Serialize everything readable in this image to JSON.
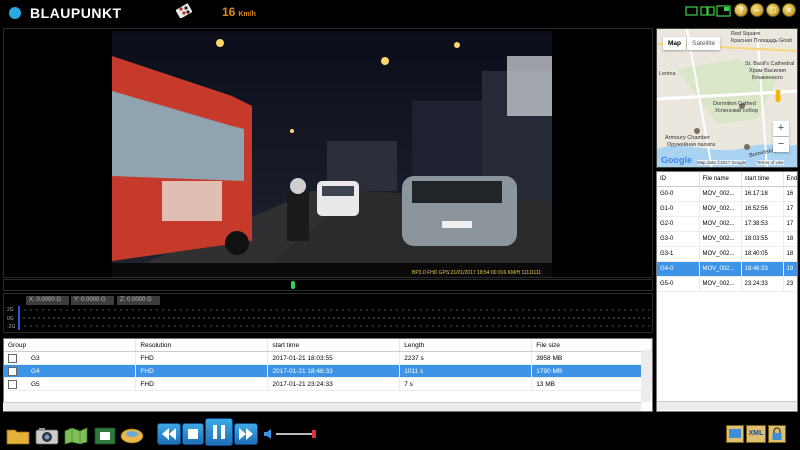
{
  "app": {
    "brand": "BLAUPUNKT"
  },
  "speed": {
    "value": "16",
    "unit": "Km/h"
  },
  "window_controls": [
    {
      "name": "help-button",
      "glyph": "?"
    },
    {
      "name": "minimize-button",
      "glyph": "–"
    },
    {
      "name": "maximize-button",
      "glyph": "□"
    },
    {
      "name": "close-button",
      "glyph": "×"
    }
  ],
  "video": {
    "overlay": "BP3.0 FHD GPS:21/01/2017 18:54:00 016 KM/H 11111111"
  },
  "gsensor": {
    "x_label": "X: 0.0000 G",
    "y_label": "Y: 0.0000 G",
    "z_label": "Z: 0.0000 G",
    "axis_ticks": [
      "2G",
      "0G",
      "-2G"
    ]
  },
  "group_table": {
    "headers": {
      "group": "Group",
      "resolution": "Resolution",
      "start_time": "start time",
      "length": "Length",
      "file_size": "File size"
    },
    "rows": [
      {
        "group": "G3",
        "resolution": "FHD",
        "start_time": "2017-01-21 18:03:55",
        "length": "2237 s",
        "file_size": "3958 MB"
      },
      {
        "group": "G4",
        "resolution": "FHD",
        "start_time": "2017-01-21 18:46:33",
        "length": "1011 s",
        "file_size": "1790 MB"
      },
      {
        "group": "G5",
        "resolution": "FHD",
        "start_time": "2017-01-21 23:24:33",
        "length": "7 s",
        "file_size": "13 MB"
      }
    ]
  },
  "map": {
    "tab_map": "Map",
    "tab_satellite": "Satellite",
    "labels": {
      "red_square": "Red Square",
      "red_square_ru": "Красная Площадь",
      "gosti": "Gosti",
      "cathedral": "St. Basil's Cathedral",
      "cathedral_ru1": "Храм Василия",
      "cathedral_ru2": "Блаженного",
      "lenina": "Lenina",
      "dormition": "Dormition Cathed",
      "dormition_ru": "Успенский собор",
      "armoury": "Armoury Chamber",
      "armoury_ru": "Оружейная палата",
      "street": "Borovitskaya pl."
    },
    "copyright": "Map data ©2017 Google",
    "terms": "Terms of Use",
    "google": "Google"
  },
  "file_list": {
    "headers": {
      "id": "ID",
      "file_name": "File name",
      "start_time": "start time",
      "end": "End"
    },
    "rows": [
      {
        "id": "G0-0",
        "file_name": "MOV_002...",
        "start_time": "16:17:18",
        "end": "16"
      },
      {
        "id": "G1-0",
        "file_name": "MOV_002...",
        "start_time": "16:52:56",
        "end": "17"
      },
      {
        "id": "G2-0",
        "file_name": "MOV_002...",
        "start_time": "17:38:53",
        "end": "17"
      },
      {
        "id": "G3-0",
        "file_name": "MOV_002...",
        "start_time": "18:03:55",
        "end": "18"
      },
      {
        "id": "G3-1",
        "file_name": "MOV_002...",
        "start_time": "18:40:05",
        "end": "18"
      },
      {
        "id": "G4-0",
        "file_name": "MOV_002...",
        "start_time": "18:46:33",
        "end": "19"
      },
      {
        "id": "G5-0",
        "file_name": "MOV_002...",
        "start_time": "23:24:33",
        "end": "23"
      }
    ]
  },
  "toolbar": {
    "xml_label": "XML"
  },
  "colors": {
    "accent": "#3d94e6",
    "speed": "#e28a12",
    "brand_dot": "#2aa8e0"
  }
}
